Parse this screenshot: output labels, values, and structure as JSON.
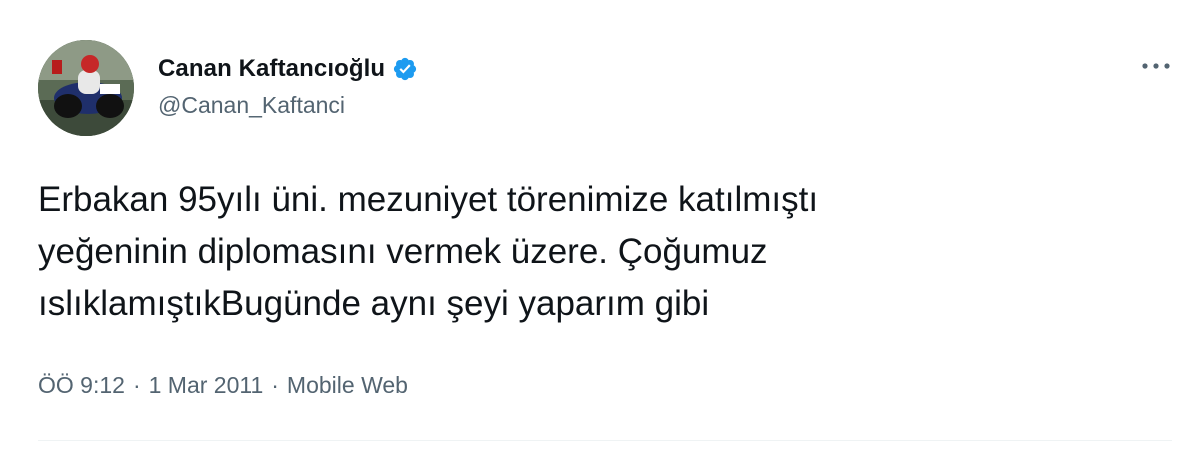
{
  "author": {
    "display_name": "Canan Kaftancıoğlu",
    "handle": "@Canan_Kaftanci",
    "verified": true
  },
  "tweet": {
    "text": "Erbakan 95yılı üni. mezuniyet törenimize katılmıştı\nyeğeninin diplomasını vermek üzere. Çoğumuz\nıslıklamıştıkBugünde aynı şeyi yaparım gibi"
  },
  "meta": {
    "time": "ÖÖ 9:12",
    "date": "1 Mar 2011",
    "source": "Mobile Web",
    "separator": "·"
  },
  "icons": {
    "more": "more-horizontal-icon",
    "verified": "verified-badge-icon"
  },
  "colors": {
    "verified_blue": "#1d9bf0",
    "text_primary": "#0f1419",
    "text_secondary": "#536471"
  }
}
